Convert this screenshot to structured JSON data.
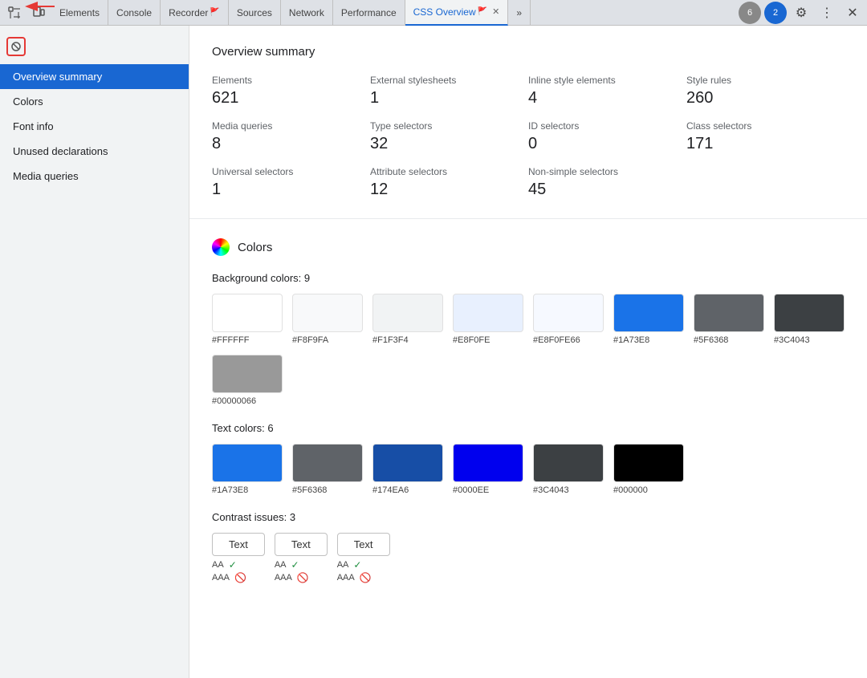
{
  "tabs": [
    {
      "label": "Elements",
      "active": false,
      "hasClose": false,
      "id": "elements"
    },
    {
      "label": "Console",
      "active": false,
      "hasClose": false,
      "id": "console"
    },
    {
      "label": "Recorder",
      "active": false,
      "hasClose": false,
      "id": "recorder",
      "hasFlag": true
    },
    {
      "label": "Sources",
      "active": false,
      "hasClose": false,
      "id": "sources"
    },
    {
      "label": "Network",
      "active": false,
      "hasClose": false,
      "id": "network"
    },
    {
      "label": "Performance",
      "active": false,
      "hasClose": false,
      "id": "performance"
    },
    {
      "label": "CSS Overview",
      "active": true,
      "hasClose": true,
      "id": "css-overview",
      "hasFlag": true
    }
  ],
  "topbar": {
    "badge1_count": "6",
    "badge2_count": "2",
    "more_label": "⋮",
    "close_label": "✕",
    "overflow_label": "»"
  },
  "sidebar": {
    "items": [
      {
        "label": "Overview summary",
        "active": true,
        "id": "overview-summary"
      },
      {
        "label": "Colors",
        "active": false,
        "id": "colors"
      },
      {
        "label": "Font info",
        "active": false,
        "id": "font-info"
      },
      {
        "label": "Unused declarations",
        "active": false,
        "id": "unused-declarations"
      },
      {
        "label": "Media queries",
        "active": false,
        "id": "media-queries"
      }
    ]
  },
  "overview": {
    "title": "Overview summary",
    "stats": [
      {
        "label": "Elements",
        "value": "621"
      },
      {
        "label": "External stylesheets",
        "value": "1"
      },
      {
        "label": "Inline style elements",
        "value": "4"
      },
      {
        "label": "Style rules",
        "value": "260"
      },
      {
        "label": "Media queries",
        "value": "8"
      },
      {
        "label": "Type selectors",
        "value": "32"
      },
      {
        "label": "ID selectors",
        "value": "0"
      },
      {
        "label": "Class selectors",
        "value": "171"
      },
      {
        "label": "Universal selectors",
        "value": "1"
      },
      {
        "label": "Attribute selectors",
        "value": "12"
      },
      {
        "label": "Non-simple selectors",
        "value": "45"
      },
      {
        "label": "",
        "value": ""
      }
    ]
  },
  "colors": {
    "section_title": "Colors",
    "background_title": "Background colors: 9",
    "background_colors": [
      {
        "hex": "#FFFFFF",
        "display": "#FFFFFF",
        "bg": "#FFFFFF"
      },
      {
        "hex": "#F8F9FA",
        "display": "#F8F9FA",
        "bg": "#F8F9FA"
      },
      {
        "hex": "#F1F3F4",
        "display": "#F1F3F4",
        "bg": "#F1F3F4"
      },
      {
        "hex": "#E8F0FE",
        "display": "#E8F0FE",
        "bg": "#E8F0FE"
      },
      {
        "hex": "#E8F0FE66",
        "display": "#E8F0FE66",
        "bg": "#E8F0FE"
      },
      {
        "hex": "#1A73E8",
        "display": "#1A73E8",
        "bg": "#1A73E8"
      },
      {
        "hex": "#5F6368",
        "display": "#5F6368",
        "bg": "#5F6368"
      },
      {
        "hex": "#3C4043",
        "display": "#3C4043",
        "bg": "#3C4043"
      },
      {
        "hex": "#00000066",
        "display": "#00000066",
        "bg": "rgba(0,0,0,0.4)"
      }
    ],
    "text_title": "Text colors: 6",
    "text_colors": [
      {
        "hex": "#1A73E8",
        "display": "#1A73E8",
        "bg": "#1A73E8"
      },
      {
        "hex": "#5F6368",
        "display": "#5F6368",
        "bg": "#5F6368"
      },
      {
        "hex": "#174EA6",
        "display": "#174EA6",
        "bg": "#174EA6"
      },
      {
        "hex": "#0000EE",
        "display": "#0000EE",
        "bg": "#0000EE"
      },
      {
        "hex": "#3C4043",
        "display": "#3C4043",
        "bg": "#3C4043"
      },
      {
        "hex": "#000000",
        "display": "#000000",
        "bg": "#000000"
      }
    ],
    "contrast_title": "Contrast issues: 3",
    "contrast_items": [
      {
        "label": "Text",
        "aa": "AA",
        "aaa": "AAA",
        "aa_pass": true,
        "aaa_pass": false
      },
      {
        "label": "Text",
        "aa": "AA",
        "aaa": "AAA",
        "aa_pass": true,
        "aaa_pass": false
      },
      {
        "label": "Text",
        "aa": "AA",
        "aaa": "AAA",
        "aa_pass": true,
        "aaa_pass": false
      }
    ]
  }
}
